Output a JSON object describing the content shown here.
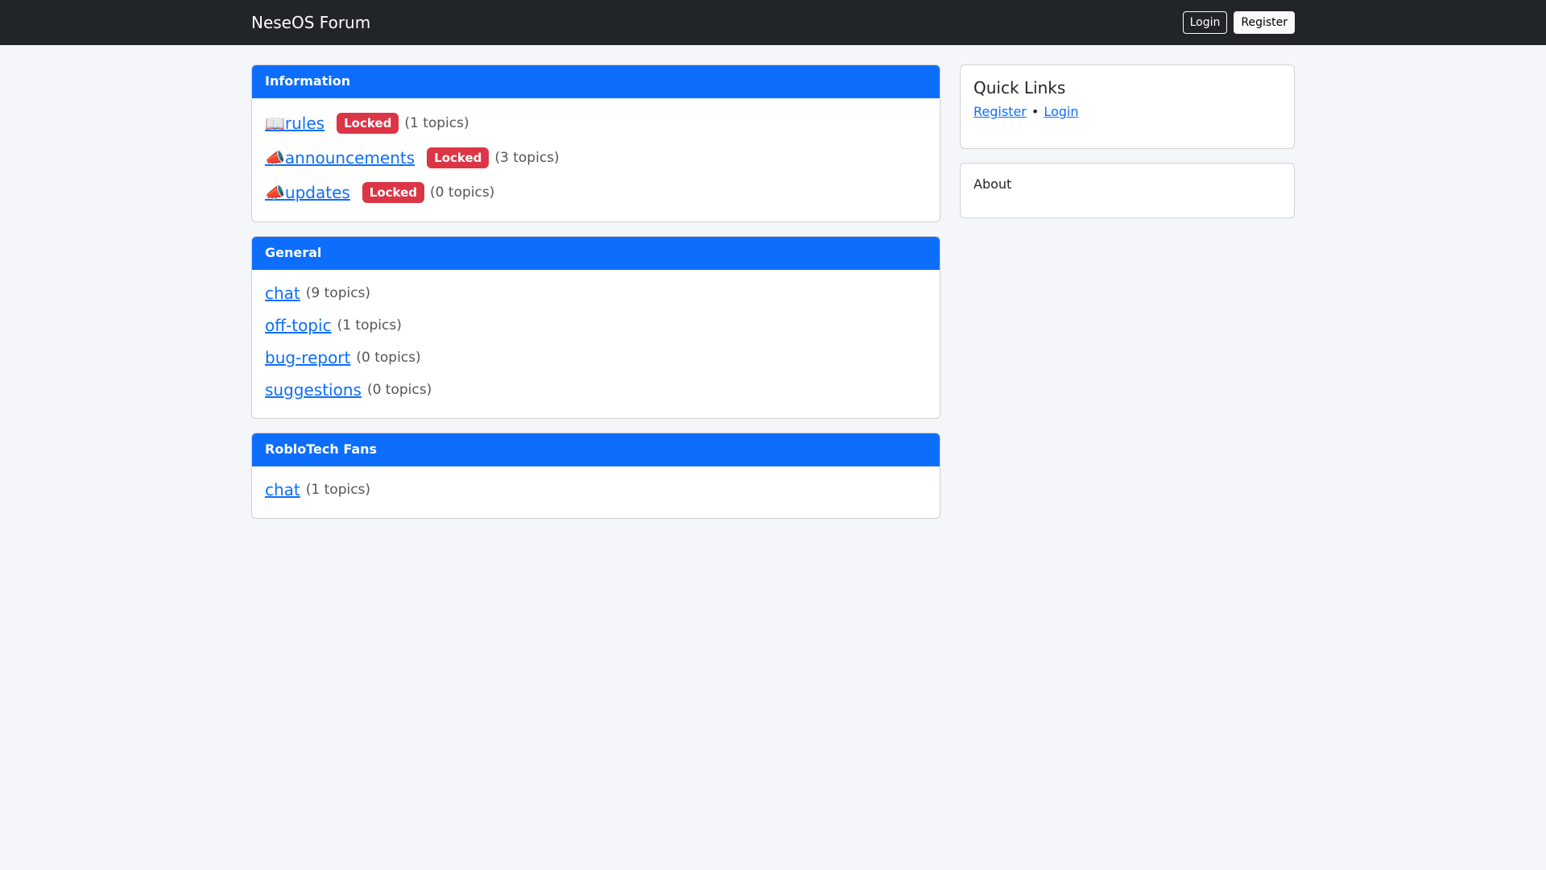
{
  "navbar": {
    "brand": "NeseOS Forum",
    "login": "Login",
    "register": "Register"
  },
  "categories": [
    {
      "title": "Information",
      "forums": [
        {
          "icon": "📖",
          "name": "rules",
          "badge": "Locked",
          "count": "(1 topics)"
        },
        {
          "icon": "📣",
          "name": "announcements",
          "badge": "Locked",
          "count": "(3 topics)"
        },
        {
          "icon": "📣",
          "name": "updates",
          "badge": "Locked",
          "count": "(0 topics)"
        }
      ]
    },
    {
      "title": "General",
      "forums": [
        {
          "name": "chat",
          "count": "(9 topics)"
        },
        {
          "name": "off-topic",
          "count": "(1 topics)"
        },
        {
          "name": "bug-report",
          "count": "(0 topics)"
        },
        {
          "name": "suggestions",
          "count": "(0 topics)"
        }
      ]
    },
    {
      "title": "RobloTech Fans",
      "forums": [
        {
          "name": "chat",
          "count": "(1 topics)"
        }
      ]
    }
  ],
  "sidebar": {
    "quick_links_title": "Quick Links",
    "register": "Register",
    "separator": "•",
    "login": "Login",
    "about_title": "About"
  },
  "colors": {
    "primary": "#0d6efd",
    "danger": "#dc3545",
    "navbar": "#212529"
  }
}
